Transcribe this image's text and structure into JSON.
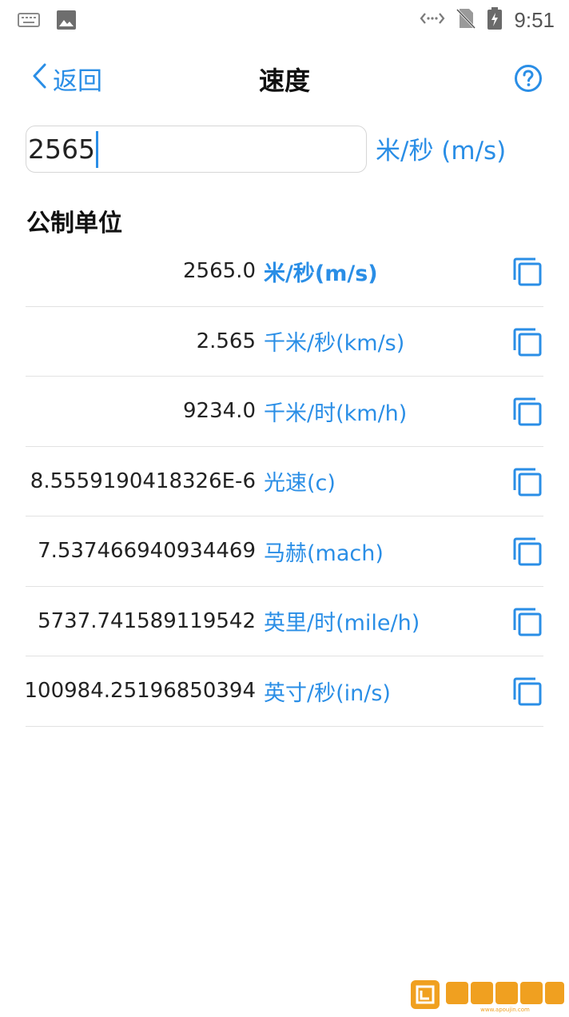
{
  "status_bar": {
    "time": "9:51",
    "icons": [
      "keyboard-icon",
      "image-icon",
      "data-sync-icon",
      "no-sim-icon",
      "battery-charging-icon"
    ]
  },
  "header": {
    "back_label": "返回",
    "title": "速度",
    "help_icon": "help-circle-icon"
  },
  "input": {
    "value": "2565",
    "unit": "米/秒 (m/s)"
  },
  "section": {
    "title": "公制单位"
  },
  "conversions": [
    {
      "value": "2565.0",
      "unit": "米/秒(m/s)"
    },
    {
      "value": "2.565",
      "unit": "千米/秒(km/s)"
    },
    {
      "value": "9234.0",
      "unit": "千米/时(km/h)"
    },
    {
      "value": "8.5559190418326E-6",
      "unit": "光速(c)"
    },
    {
      "value": "7.537466940934469",
      "unit": "马赫(mach)"
    },
    {
      "value": "5737.741589119542",
      "unit": "英里/时(mile/h)"
    },
    {
      "value": "100984.25196850394",
      "unit": "英寸/秒(in/s)"
    }
  ],
  "watermark": {
    "text": "欧全软件园",
    "url_text": "www.apoujin.com"
  },
  "colors": {
    "accent": "#2a8ee6",
    "divider": "#e2e2e2",
    "watermark": "#f0a020"
  }
}
